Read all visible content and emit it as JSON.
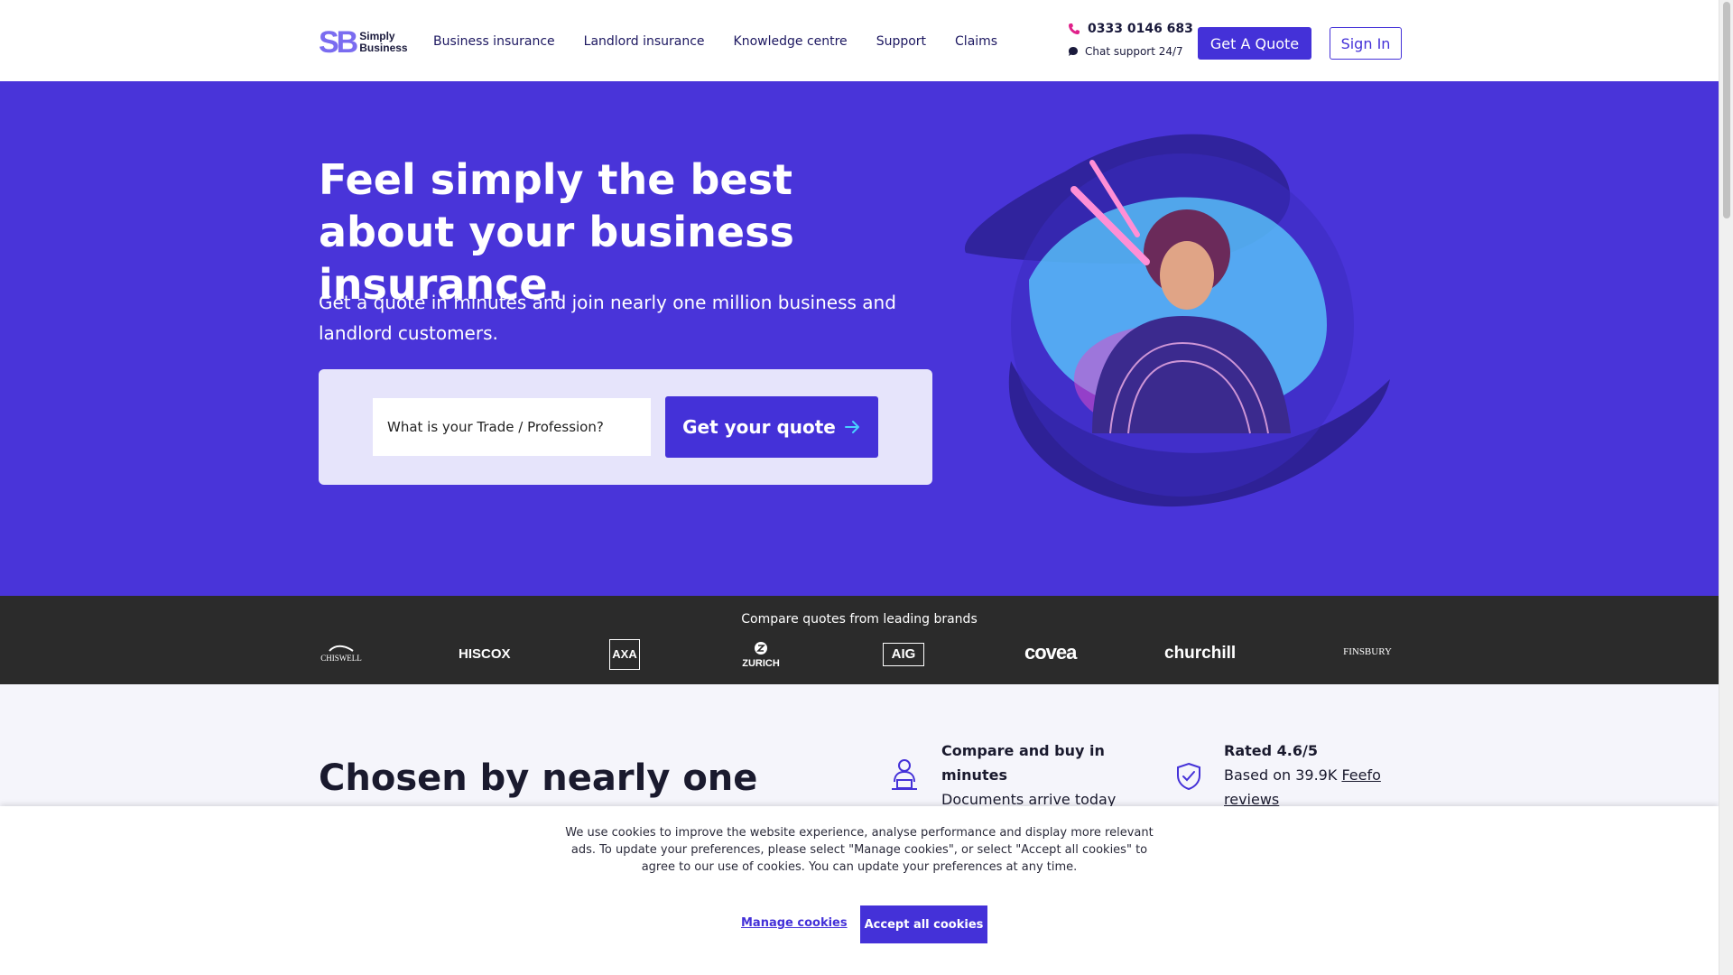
{
  "header": {
    "logo_mark": "SB",
    "logo_line1": "Simply",
    "logo_line2": "Business",
    "nav": [
      "Business insurance",
      "Landlord insurance",
      "Knowledge centre",
      "Support",
      "Claims"
    ],
    "phone": "0333 0146 683",
    "chat": "Chat support 24/7",
    "quote_button": "Get A Quote",
    "signin_button": "Sign In"
  },
  "hero": {
    "title": "Feel simply the best about your business insurance.",
    "subtitle": "Get a quote in minutes and join nearly one million business and landlord customers.",
    "trade_placeholder": "What is your Trade / Profession?",
    "cta": "Get your quote"
  },
  "brands": {
    "title": "Compare quotes from leading brands",
    "items": [
      "CHISWELL",
      "HISCOX",
      "AXA",
      "ZURICH",
      "AIG",
      "coveа",
      "churchill",
      "FINSBURY"
    ]
  },
  "content": {
    "heading": "Chosen by nearly one million small businesses and landlords",
    "feature1_title": "Compare and buy in minutes",
    "feature1_text": "Documents arrive today",
    "feature2_title": "Rated 4.6/5",
    "feature2_prefix": "Based on 39.9K",
    "feature2_link": "Feefo reviews"
  },
  "cookie": {
    "text": "We use cookies to improve the website experience, analyse performance and display more relevant ads. To update your preferences, please select \"Manage cookies\", or select \"Accept all cookies\" to agree to our use of cookies. You can update your preferences at any time.",
    "manage": "Manage cookies",
    "accept": "Accept all cookies"
  },
  "colors": {
    "brand_purple": "#4934d9",
    "button_purple": "#4431d8",
    "brands_bar": "#2b2b2b"
  }
}
